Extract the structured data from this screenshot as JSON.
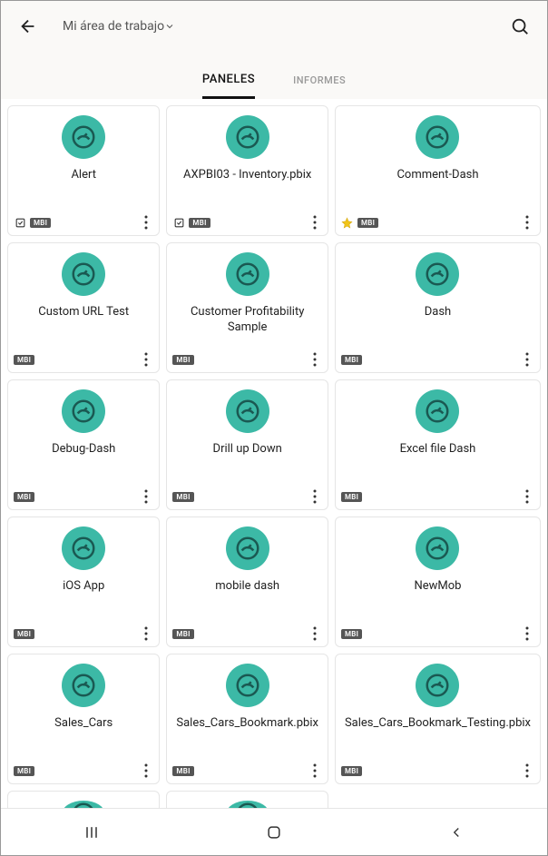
{
  "header": {
    "workspace_label": "Mi área de trabajo"
  },
  "tabs": [
    {
      "label": "PANELES",
      "active": true
    },
    {
      "label": "INFORMES",
      "active": false
    }
  ],
  "badge_text": "MBI",
  "items": [
    {
      "title": "Alert",
      "sensitivity": true,
      "star": false,
      "mbi": true
    },
    {
      "title": "AXPBI03 - Inventory.pbix",
      "sensitivity": true,
      "star": false,
      "mbi": true
    },
    {
      "title": "Comment-Dash",
      "sensitivity": false,
      "star": true,
      "mbi": true
    },
    {
      "title": "Custom URL Test",
      "sensitivity": false,
      "star": false,
      "mbi": true
    },
    {
      "title": "Customer Profitability Sample",
      "sensitivity": false,
      "star": false,
      "mbi": true
    },
    {
      "title": "Dash",
      "sensitivity": false,
      "star": false,
      "mbi": true
    },
    {
      "title": "Debug-Dash",
      "sensitivity": false,
      "star": false,
      "mbi": true
    },
    {
      "title": "Drill up Down",
      "sensitivity": false,
      "star": false,
      "mbi": true
    },
    {
      "title": "Excel file Dash",
      "sensitivity": false,
      "star": false,
      "mbi": true
    },
    {
      "title": "iOS App",
      "sensitivity": false,
      "star": false,
      "mbi": true
    },
    {
      "title": "mobile dash",
      "sensitivity": false,
      "star": false,
      "mbi": true
    },
    {
      "title": "NewMob",
      "sensitivity": false,
      "star": false,
      "mbi": true
    },
    {
      "title": "Sales_Cars",
      "sensitivity": false,
      "star": false,
      "mbi": true
    },
    {
      "title": "Sales_Cars_Bookmark.pbix",
      "sensitivity": false,
      "star": false,
      "mbi": true
    },
    {
      "title": "Sales_Cars_Bookmark_Testing.pbix",
      "sensitivity": false,
      "star": false,
      "mbi": true
    }
  ]
}
